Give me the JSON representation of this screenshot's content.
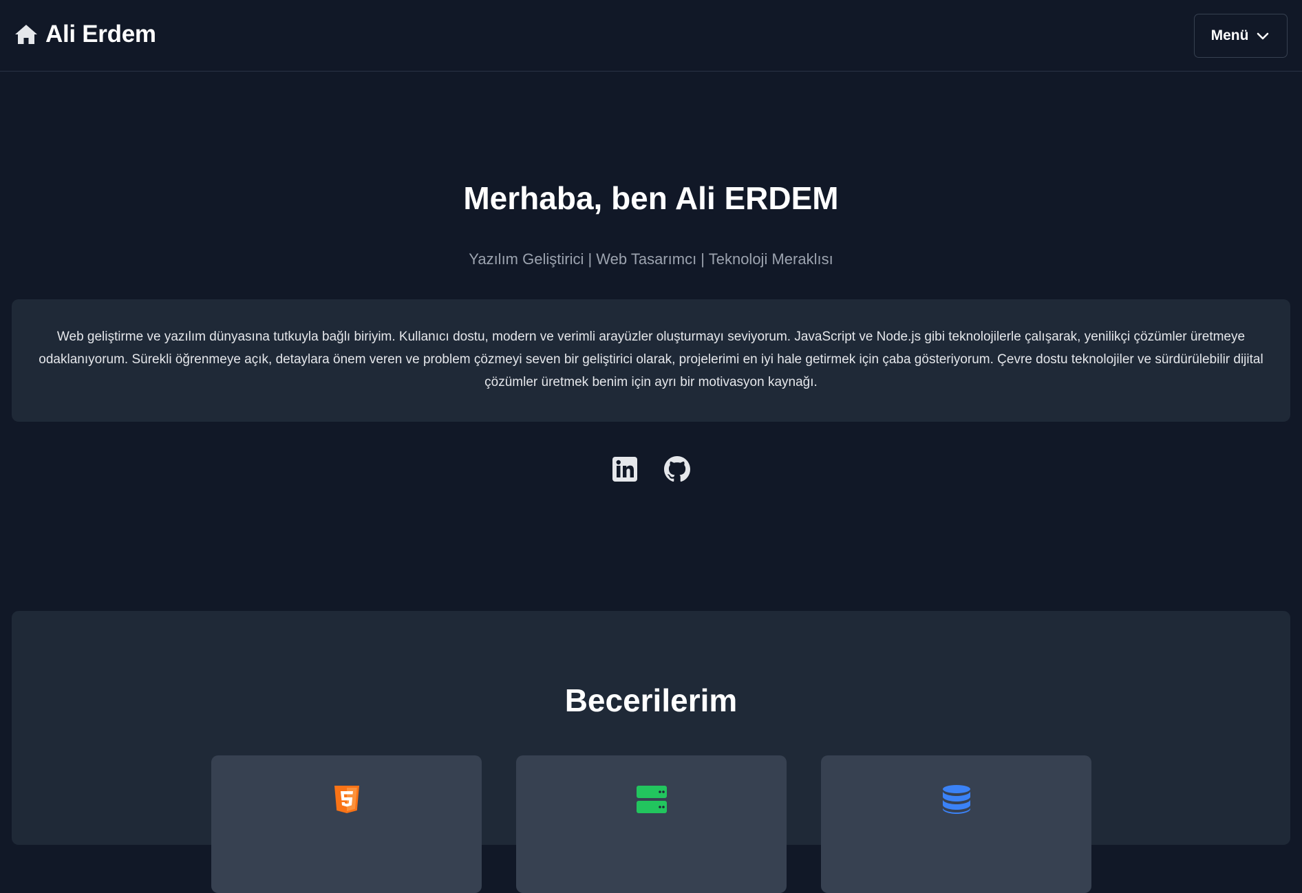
{
  "header": {
    "brand_name": "Ali Erdem",
    "brand_icon": "home-icon",
    "menu_label": "Menü",
    "menu_icon": "chevron-down-icon"
  },
  "hero": {
    "title": "Merhaba, ben Ali ERDEM",
    "subtitle": "Yazılım Geliştirici | Web Tasarımcı | Teknoloji Meraklısı",
    "about": "Web geliştirme ve yazılım dünyasına tutkuyla bağlı biriyim. Kullanıcı dostu, modern ve verimli arayüzler oluşturmayı seviyorum. JavaScript ve Node.js gibi teknolojilerle çalışarak, yenilikçi çözümler üretmeye odaklanıyorum. Sürekli öğrenmeye açık, detaylara önem veren ve problem çözmeyi seven bir geliştirici olarak, projelerimi en iyi hale getirmek için çaba gösteriyorum. Çevre dostu teknolojiler ve sürdürülebilir dijital çözümler üretmek benim için ayrı bir motivasyon kaynağı."
  },
  "socials": [
    {
      "icon": "linkedin-icon"
    },
    {
      "icon": "github-icon"
    }
  ],
  "skills": {
    "title": "Becerilerim",
    "cards": [
      {
        "icon": "html5-icon",
        "color": "#f97316"
      },
      {
        "icon": "server-icon",
        "color": "#22c55e"
      },
      {
        "icon": "database-icon",
        "color": "#3b82f6"
      }
    ]
  },
  "colors": {
    "background": "#111827",
    "card": "#1f2937",
    "skill_card": "#374151",
    "subtitle": "#9ca3af"
  }
}
